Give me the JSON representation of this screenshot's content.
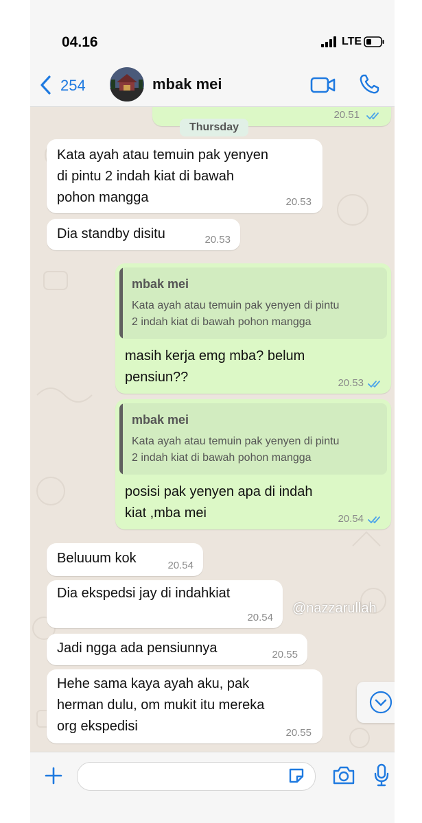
{
  "status": {
    "time": "04.16",
    "network": "LTE"
  },
  "header": {
    "back_count": "254",
    "contact_name": "mbak mei"
  },
  "day_label": "Thursday",
  "messages": [
    {
      "text": "",
      "time": "20.51"
    },
    {
      "text": "Kata ayah atau temuin pak yenyen\ndi pintu 2 indah kiat di bawah\npohon mangga",
      "time": "20.53"
    },
    {
      "text": "Dia standby disitu",
      "time": "20.53"
    },
    {
      "quote_name": "mbak mei",
      "quote_text": "Kata ayah atau temuin pak yenyen di pintu\n2 indah kiat di bawah pohon mangga",
      "text": "masih kerja emg mba? belum\npensiun??",
      "time": "20.53"
    },
    {
      "quote_name": "mbak mei",
      "quote_text": "Kata ayah atau temuin pak yenyen di pintu\n2 indah kiat di bawah pohon mangga",
      "text": "posisi pak yenyen apa di indah\nkiat ,mba mei",
      "time": "20.54"
    },
    {
      "text": "Beluuum kok",
      "time": "20.54"
    },
    {
      "text": "Dia ekspedsi jay di indahkiat",
      "time": "20.54"
    },
    {
      "text": "Jadi ngga ada pensiunnya",
      "time": "20.55"
    },
    {
      "text": "Hehe sama kaya ayah aku, pak\nherman dulu, om mukit itu mereka\norg ekspedisi",
      "time": "20.55"
    }
  ],
  "watermark": "@nazzarullah",
  "colors": {
    "accent": "#1f7ae0",
    "outgoing_bubble": "#dcf8c6",
    "incoming_bubble": "#ffffff",
    "chat_bg": "#ece5dd"
  }
}
